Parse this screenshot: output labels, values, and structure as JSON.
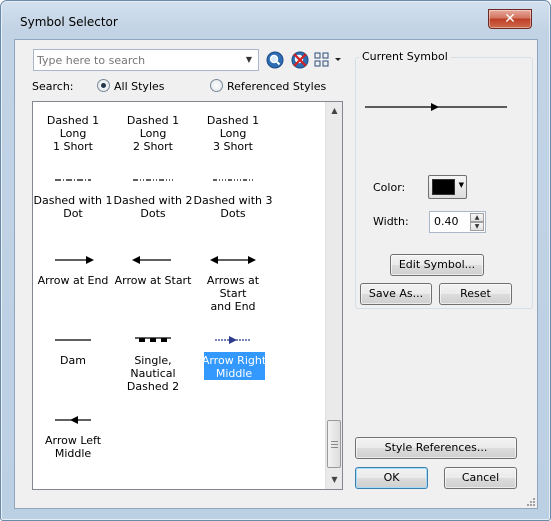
{
  "window": {
    "title": "Symbol Selector",
    "close_glyph": "✕"
  },
  "search": {
    "placeholder": "Type here to search",
    "label": "Search:",
    "options": [
      {
        "label": "All Styles",
        "checked": true
      },
      {
        "label": "Referenced Styles",
        "checked": false
      }
    ],
    "icons": [
      "search-icon",
      "clear-search-icon",
      "view-options-icon"
    ]
  },
  "symbols": [
    {
      "label_lines": [
        "Dashed 1 Long",
        "1 Short"
      ],
      "style": "dashed-1-long-1-short",
      "selected": false
    },
    {
      "label_lines": [
        "Dashed 1 Long",
        "2 Short"
      ],
      "style": "dashed-1-long-2-short",
      "selected": false
    },
    {
      "label_lines": [
        "Dashed 1 Long",
        "3 Short"
      ],
      "style": "dashed-1-long-3-short",
      "selected": false
    },
    {
      "label_lines": [
        "Dashed with 1",
        "Dot"
      ],
      "style": "dashed-with-1-dot",
      "selected": false
    },
    {
      "label_lines": [
        "Dashed with 2",
        "Dots"
      ],
      "style": "dashed-with-2-dots",
      "selected": false
    },
    {
      "label_lines": [
        "Dashed with 3",
        "Dots"
      ],
      "style": "dashed-with-3-dots",
      "selected": false
    },
    {
      "label_lines": [
        "Arrow at End",
        ""
      ],
      "style": "arrow-at-end",
      "selected": false
    },
    {
      "label_lines": [
        "Arrow at Start",
        ""
      ],
      "style": "arrow-at-start",
      "selected": false
    },
    {
      "label_lines": [
        "Arrows at Start",
        "and End"
      ],
      "style": "arrows-at-start-and-end",
      "selected": false
    },
    {
      "label_lines": [
        "Dam",
        ""
      ],
      "style": "dam",
      "selected": false
    },
    {
      "label_lines": [
        "Single, Nautical",
        "Dashed 2"
      ],
      "style": "single-nautical-dashed-2",
      "selected": false
    },
    {
      "label_lines": [
        "Arrow Right",
        "Middle"
      ],
      "style": "arrow-right-middle",
      "selected": true
    },
    {
      "label_lines": [
        "Arrow Left",
        "Middle"
      ],
      "style": "arrow-left-middle",
      "selected": false
    }
  ],
  "current_symbol": {
    "group_label": "Current Symbol",
    "color_label": "Color:",
    "color_value": "#000000",
    "width_label": "Width:",
    "width_value": "0.40"
  },
  "buttons": {
    "edit_symbol": "Edit Symbol...",
    "save_as": "Save As...",
    "reset": "Reset",
    "style_references": "Style References...",
    "ok": "OK",
    "cancel": "Cancel"
  },
  "colors": {
    "selection": "#3399ff",
    "window_frame": "#bcd0e4",
    "dialog_bg": "#f0f0f0"
  }
}
